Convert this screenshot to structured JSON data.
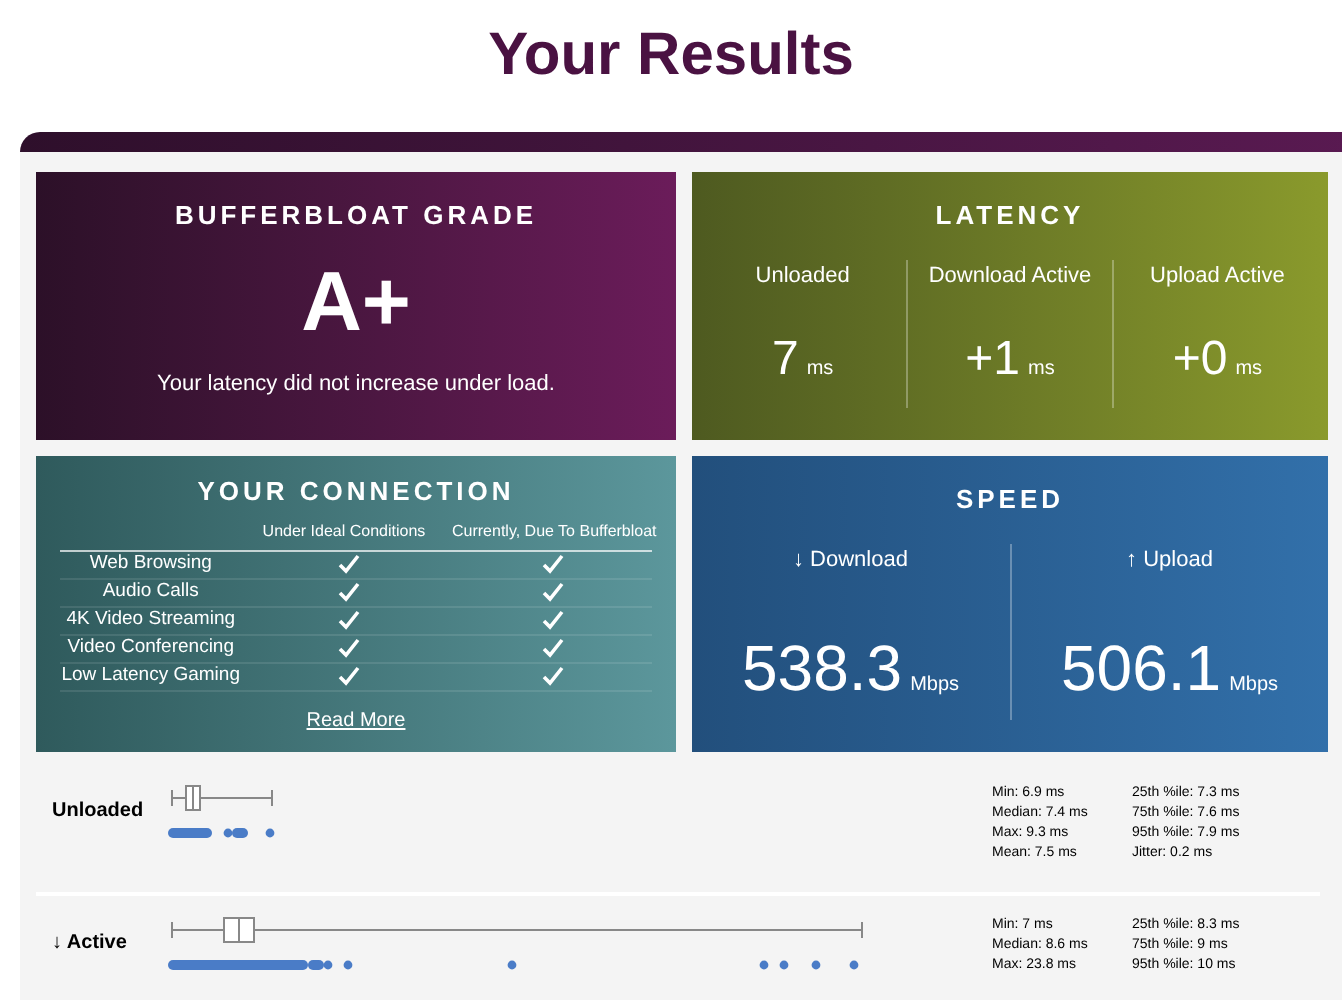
{
  "title": "Your Results",
  "grade": {
    "heading": "BUFFERBLOAT GRADE",
    "value": "A+",
    "note": "Your latency did not increase under load."
  },
  "latency": {
    "heading": "LATENCY",
    "items": [
      {
        "label": "Unloaded",
        "value": "7",
        "unit": "ms"
      },
      {
        "label": "Download Active",
        "value": "+1",
        "unit": "ms"
      },
      {
        "label": "Upload Active",
        "value": "+0",
        "unit": "ms"
      }
    ]
  },
  "connection": {
    "heading": "YOUR CONNECTION",
    "columns": [
      "Under Ideal Conditions",
      "Currently, Due To Bufferbloat"
    ],
    "rows": [
      {
        "name": "Web Browsing",
        "ideal": true,
        "current": true
      },
      {
        "name": "Audio Calls",
        "ideal": true,
        "current": true
      },
      {
        "name": "4K Video Streaming",
        "ideal": true,
        "current": true
      },
      {
        "name": "Video Conferencing",
        "ideal": true,
        "current": true
      },
      {
        "name": "Low Latency Gaming",
        "ideal": true,
        "current": true
      }
    ],
    "link": "Read More"
  },
  "speed": {
    "heading": "SPEED",
    "items": [
      {
        "label": "↓ Download",
        "value": "538.3",
        "unit": "Mbps"
      },
      {
        "label": "↑ Upload",
        "value": "506.1",
        "unit": "Mbps"
      }
    ]
  },
  "stats": [
    {
      "label": "Unloaded",
      "left": [
        "Min: 6.9 ms",
        "Median: 7.4 ms",
        "Max: 9.3 ms",
        "Mean: 7.5 ms"
      ],
      "right": [
        "25th %ile: 7.3 ms",
        "75th %ile: 7.6 ms",
        "95th %ile: 7.9 ms",
        "Jitter: 0.2 ms"
      ]
    },
    {
      "label": "↓ Active",
      "left": [
        "Min: 7 ms",
        "Median: 8.6 ms",
        "Max: 23.8 ms"
      ],
      "right": [
        "25th %ile: 8.3 ms",
        "75th %ile: 9 ms",
        "95th %ile: 10 ms"
      ]
    }
  ]
}
